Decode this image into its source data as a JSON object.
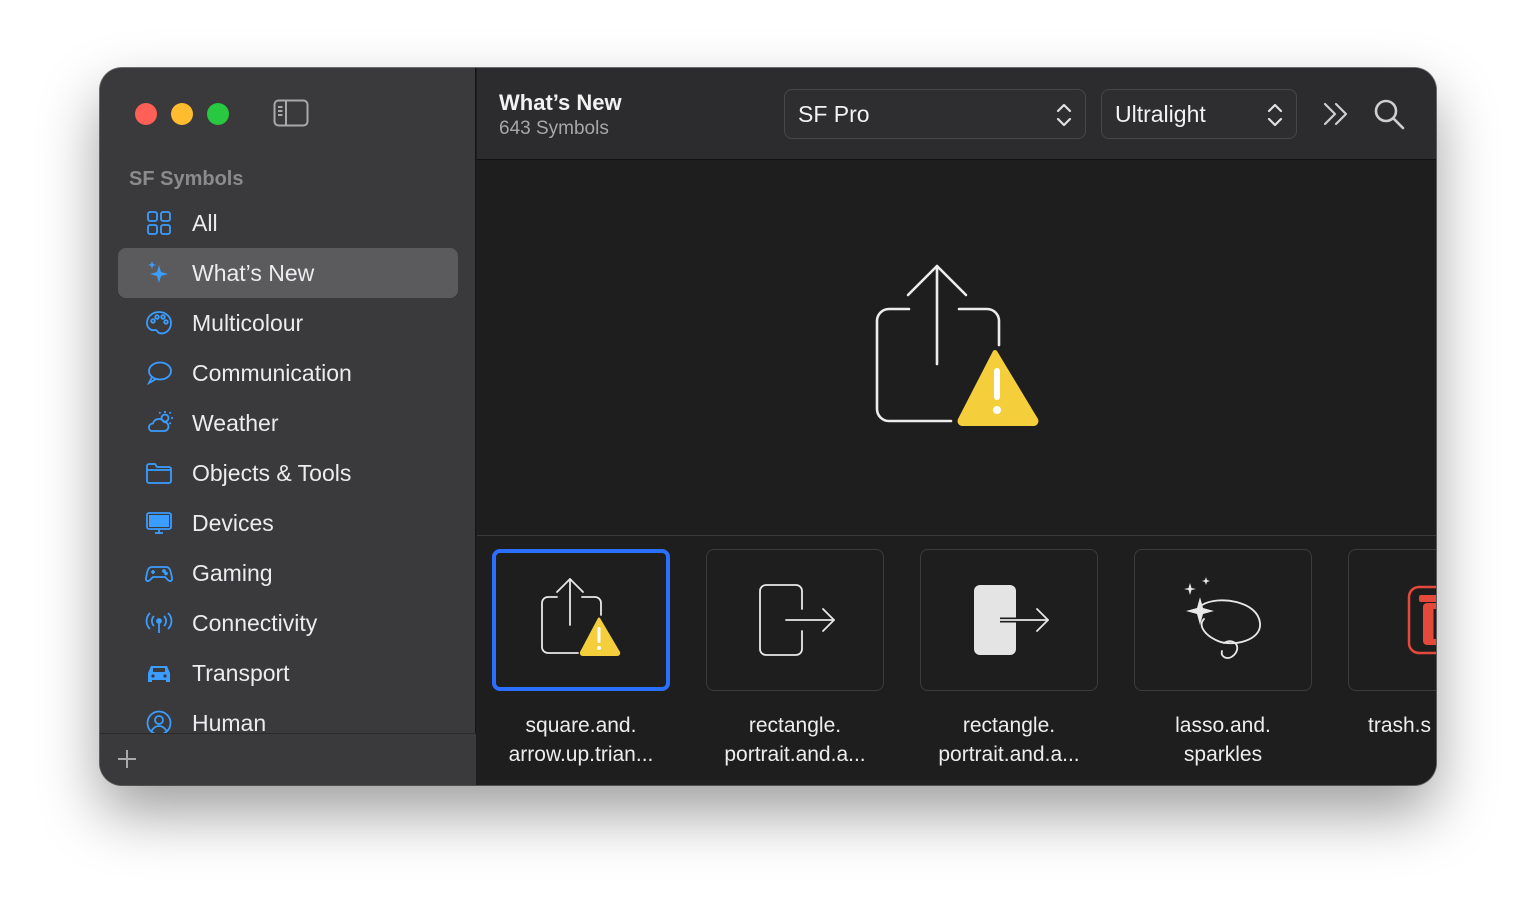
{
  "sidebar": {
    "section_title": "SF Symbols",
    "items": [
      {
        "label": "All",
        "icon": "grid-icon",
        "selected": false
      },
      {
        "label": "What’s New",
        "icon": "sparkles-icon",
        "selected": true
      },
      {
        "label": "Multicolour",
        "icon": "paintpalette-icon",
        "selected": false
      },
      {
        "label": "Communication",
        "icon": "message-bubble-icon",
        "selected": false
      },
      {
        "label": "Weather",
        "icon": "cloud-sun-icon",
        "selected": false
      },
      {
        "label": "Objects & Tools",
        "icon": "folder-icon",
        "selected": false
      },
      {
        "label": "Devices",
        "icon": "desktop-icon",
        "selected": false
      },
      {
        "label": "Gaming",
        "icon": "gamecontroller-icon",
        "selected": false
      },
      {
        "label": "Connectivity",
        "icon": "antenna-icon",
        "selected": false
      },
      {
        "label": "Transport",
        "icon": "car-icon",
        "selected": false
      },
      {
        "label": "Human",
        "icon": "person-circle-icon",
        "selected": false
      }
    ]
  },
  "toolbar": {
    "title": "What’s New",
    "subtitle": "643 Symbols",
    "font_value": "SF Pro",
    "weight_value": "Ultralight"
  },
  "symbols": [
    {
      "line1": "square.and.",
      "line2": "arrow.up.trian...",
      "selected": true
    },
    {
      "line1": "rectangle.",
      "line2": "portrait.and.a...",
      "selected": false
    },
    {
      "line1": "rectangle.",
      "line2": "portrait.and.a...",
      "selected": false
    },
    {
      "line1": "lasso.and.",
      "line2": "sparkles",
      "selected": false
    },
    {
      "line1": "trash.s",
      "line2": "",
      "selected": false
    }
  ],
  "colors": {
    "accent": "#2b6fff",
    "icon_blue": "#3b9dff",
    "warning_yellow": "#f5cf3b",
    "trash_red": "#e5493a"
  }
}
